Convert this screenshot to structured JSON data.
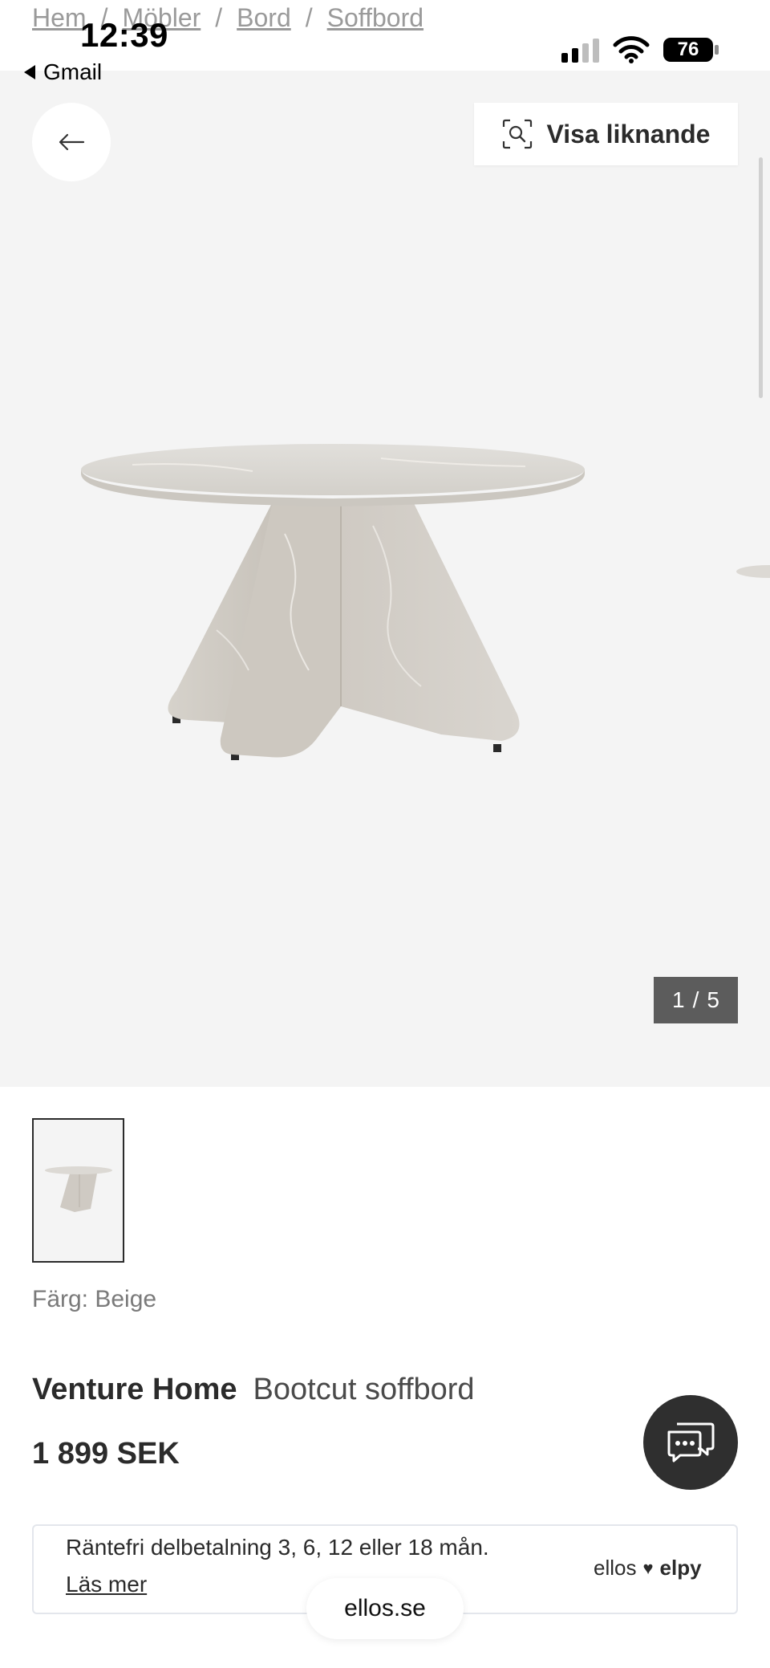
{
  "breadcrumb": {
    "items": [
      "Hem",
      "Möbler",
      "Bord",
      "Soffbord"
    ],
    "separator": "/"
  },
  "status_bar": {
    "time": "12:39",
    "back_app": "Gmail",
    "battery": "76"
  },
  "hero": {
    "similar_button": "Visa liknande",
    "counter_current": "1",
    "counter_separator": "/",
    "counter_total": "5"
  },
  "product": {
    "color_label": "Färg: Beige",
    "brand": "Venture Home",
    "name": "Bootcut soffbord",
    "price": "1 899 SEK"
  },
  "payment": {
    "text": "Räntefri delbetalning 3, 6, 12 eller 18 mån.",
    "link": "Läs mer",
    "logo_left": "ellos",
    "logo_right": "elpy"
  },
  "browser": {
    "url": "ellos.se"
  },
  "colors": {
    "hero_bg": "#f4f4f4",
    "counter_bg": "#5c5c5c",
    "chat_bg": "#2f2f2f",
    "text": "#2b2b2b"
  }
}
